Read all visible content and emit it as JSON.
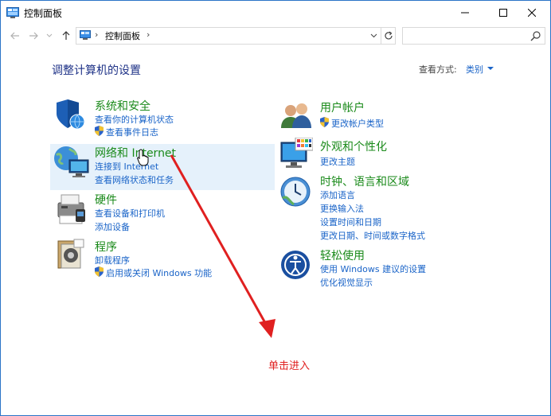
{
  "window": {
    "title": "控制面板",
    "app_icon": "control-panel-icon"
  },
  "address_bar": {
    "path": "控制面板",
    "separator": "›"
  },
  "search": {
    "placeholder": ""
  },
  "main": {
    "heading": "调整计算机的设置",
    "view_by_label": "查看方式:",
    "view_by_value": "类别"
  },
  "categories": {
    "system": {
      "title": "系统和安全",
      "links": [
        "查看你的计算机状态",
        "查看事件日志"
      ],
      "icon": "shield-globe-icon"
    },
    "network": {
      "title": "网络和 Internet",
      "links": [
        "连接到 Internet",
        "查看网络状态和任务"
      ],
      "icon": "network-globe-icon"
    },
    "hardware": {
      "title": "硬件",
      "links": [
        "查看设备和打印机",
        "添加设备"
      ],
      "icon": "printer-icon"
    },
    "programs": {
      "title": "程序",
      "links": [
        "卸载程序",
        "启用或关闭 Windows 功能"
      ],
      "icon": "programs-icon"
    },
    "accounts": {
      "title": "用户帐户",
      "links": [
        "更改帐户类型"
      ],
      "icon": "users-icon"
    },
    "appearance": {
      "title": "外观和个性化",
      "links": [
        "更改主题"
      ],
      "icon": "monitor-palette-icon"
    },
    "clock": {
      "title": "时钟、语言和区域",
      "links": [
        "添加语言",
        "更换输入法",
        "设置时间和日期",
        "更改日期、时间或数字格式"
      ],
      "icon": "clock-globe-icon"
    },
    "ease": {
      "title": "轻松使用",
      "links": [
        "使用 Windows 建议的设置",
        "优化视觉显示"
      ],
      "icon": "ease-of-access-icon"
    }
  },
  "annotation": {
    "text": "单击进入",
    "color": "#e02020"
  },
  "colors": {
    "category_green": "#1a8a1a",
    "link_blue": "#1a64c8",
    "heading_blue": "#1e3287",
    "hover_bg": "#e5f1fb"
  }
}
